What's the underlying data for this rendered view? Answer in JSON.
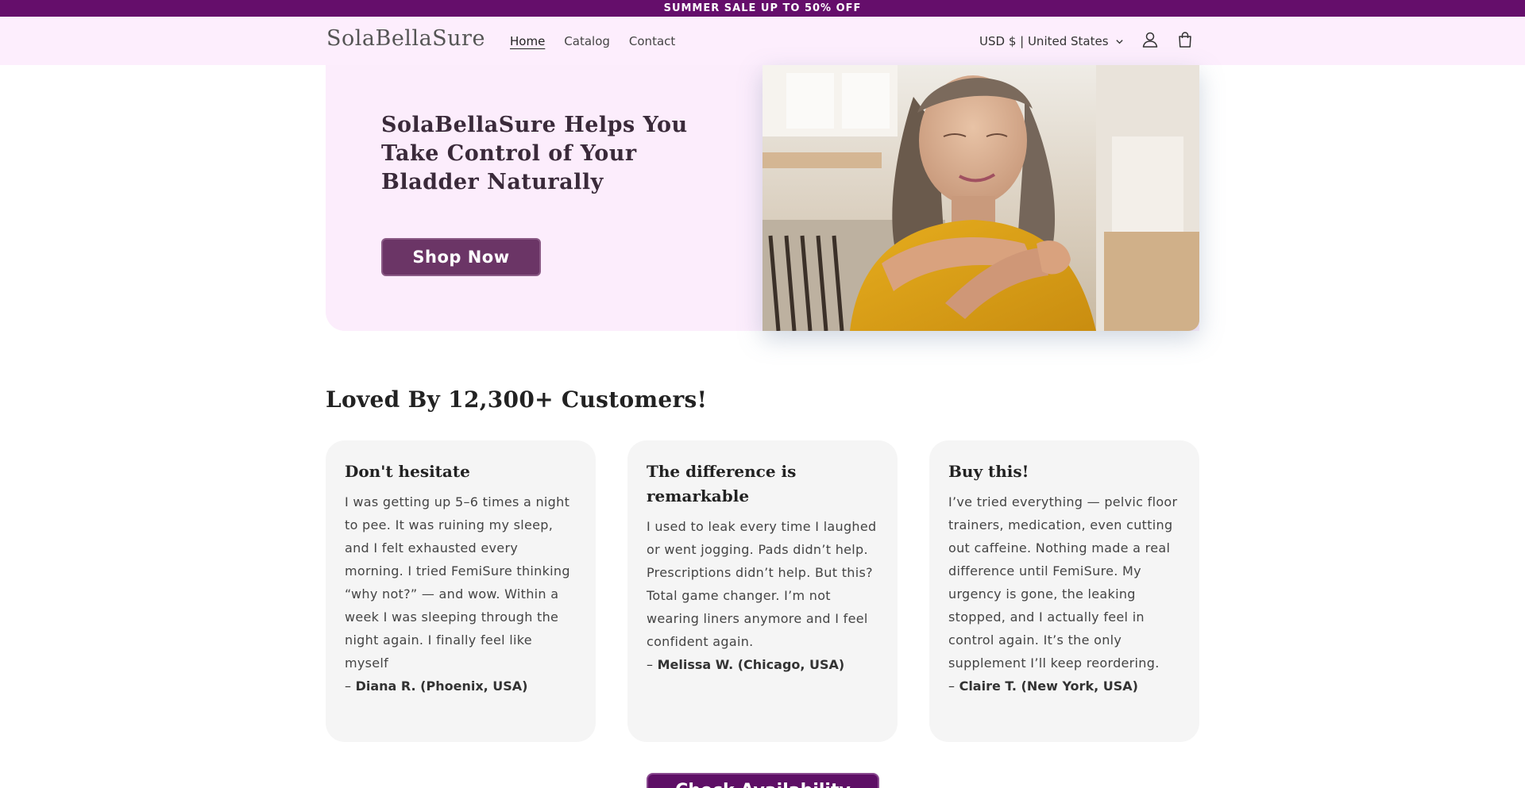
{
  "announcement": "SUMMER SALE UP TO 50% OFF",
  "header": {
    "logo": "SolaBellaSure",
    "nav": [
      "Home",
      "Catalog",
      "Contact"
    ],
    "currency": "USD $ | United States"
  },
  "hero": {
    "title": "SolaBellaSure Helps You Take Control of Your Bladder Naturally",
    "button": "Shop Now"
  },
  "reviews": {
    "title": "Loved By 12,300+ Customers!",
    "items": [
      {
        "heading": "Don't hesitate",
        "body": "I was getting up 5–6 times a night to pee. It was ruining my sleep, and I felt exhausted every morning. I tried FemiSure thinking “why not?” — and wow. Within a week I was sleeping through the night again. I finally feel like myself",
        "dash": "–",
        "author": "Diana R. (Phoenix, USA)"
      },
      {
        "heading": "The difference is remarkable",
        "body": "I used to leak every time I laughed or went jogging. Pads didn’t help. Prescriptions didn’t help. But this? Total game changer. I’m not wearing liners anymore and I feel confident again.",
        "dash": "–",
        "author": "Melissa W. (Chicago, USA)"
      },
      {
        "heading": "Buy this!",
        "body": "I’ve tried everything — pelvic floor trainers, medication, even cutting out caffeine. Nothing made a real difference until FemiSure. My urgency is gone, the leaking stopped, and I actually feel in control again. It’s the only supplement I’ll keep reordering.",
        "dash": "–",
        "author": "Claire T. (New York, USA)"
      }
    ]
  },
  "cta": "Check Availability",
  "colors": {
    "announcement_bg": "#650e6b",
    "header_bg": "#fdeefd",
    "hero_bg": "#fcedfc",
    "shop_button": "#6b3566",
    "cta_button": "#5e0f66",
    "card_bg": "#f5f5f5"
  },
  "icons": {
    "currency_dropdown": "chevron-down-icon",
    "account": "user-icon",
    "cart": "shopping-bag-icon"
  }
}
